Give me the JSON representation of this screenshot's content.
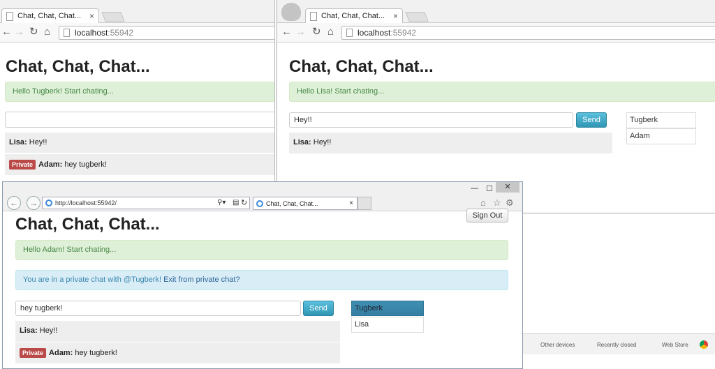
{
  "window1": {
    "tab_title": "Chat, Chat, Chat...",
    "url_host": "localhost",
    "url_port": ":55942",
    "heading": "Chat, Chat, Chat...",
    "welcome": "Hello Tugberk! Start chating...",
    "input_value": "",
    "messages": [
      {
        "sender": "Lisa:",
        "text": " Hey!!",
        "private": false
      },
      {
        "sender": "Adam:",
        "text": " hey tugberk!",
        "private": true,
        "badge": "Private"
      }
    ]
  },
  "window2": {
    "tab_title": "Chat, Chat, Chat...",
    "url_host": "localhost",
    "url_port": ":55942",
    "heading": "Chat, Chat, Chat...",
    "welcome": "Hello Lisa! Start chating...",
    "input_value": "Hey!!",
    "send_label": "Send",
    "messages": [
      {
        "sender": "Lisa:",
        "text": " Hey!!"
      }
    ],
    "users": [
      "Tugberk",
      "Adam"
    ]
  },
  "window3": {
    "address": "http://localhost:55942/",
    "tab_title": "Chat, Chat, Chat...",
    "heading": "Chat, Chat, Chat...",
    "sign_out_label": "Sign Out",
    "welcome": "Hello Adam! Start chating...",
    "private_notice_prefix": "You are in a private chat with @Tugberk! ",
    "private_notice_link": "Exit from private chat?",
    "input_value": "hey tugberk!",
    "send_label": "Send",
    "messages": [
      {
        "sender": "Lisa:",
        "text": " Hey!!"
      },
      {
        "sender": "Adam:",
        "text": " hey tugberk!",
        "badge": "Private"
      }
    ],
    "users": [
      "Tugberk",
      "Lisa"
    ]
  },
  "bottom_bar": {
    "other_devices": "Other devices",
    "recently_closed": "Recently closed",
    "web_store": "Web Store"
  },
  "colors": {
    "send_button": "#2f96b4",
    "private_badge": "#b94a48",
    "success_bg": "#dff0d8",
    "info_bg": "#d9edf7"
  }
}
